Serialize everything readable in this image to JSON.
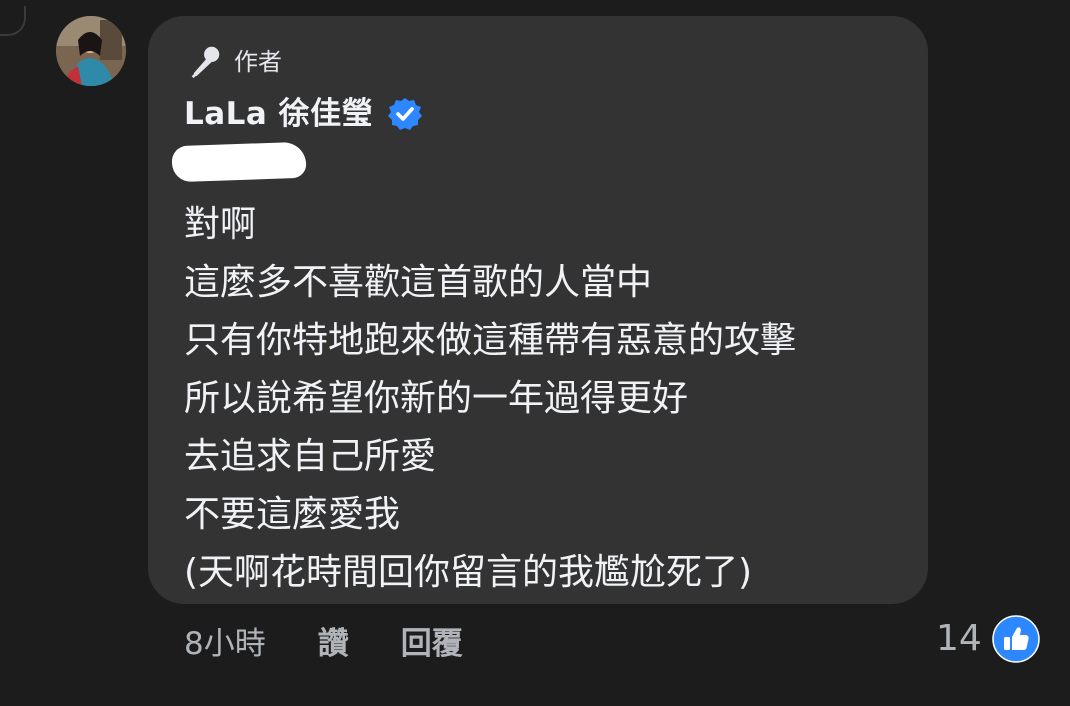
{
  "comment": {
    "badge": {
      "icon": "microphone-icon",
      "label": "作者"
    },
    "author": {
      "name": "LaLa 徐佳瑩",
      "verified_icon": "verified-badge-icon",
      "verified_color": "#2d88ff"
    },
    "lines": [
      "對啊",
      "這麼多不喜歡這首歌的人當中",
      "只有你特地跑來做這種帶有惡意的攻擊",
      "所以說希望你新的一年過得更好",
      "去追求自己所愛",
      "不要這麼愛我",
      "(天啊花時間回你留言的我尷尬死了)"
    ]
  },
  "meta": {
    "time": "8小時",
    "like_label": "讚",
    "reply_label": "回覆"
  },
  "reactions": {
    "count": "14",
    "icon": "like-thumb-icon",
    "color": "#2d88ff"
  },
  "colors": {
    "background": "#1c1c1d",
    "bubble": "#333334",
    "meta_text": "#b0b3b8",
    "body_text": "#f0f2f5"
  }
}
